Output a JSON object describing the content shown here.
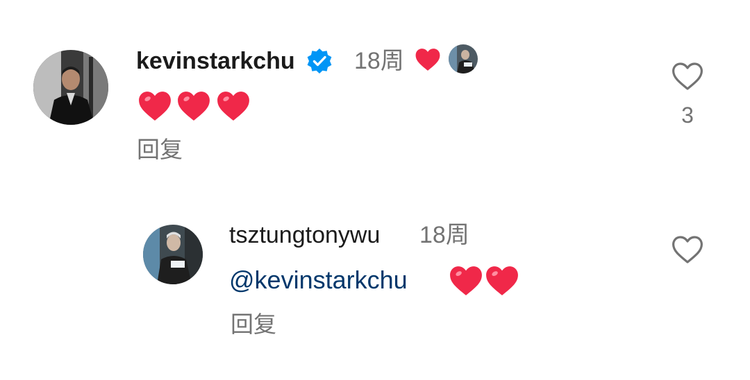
{
  "comment": {
    "username": "kevinstarkchu",
    "verified": true,
    "time": "18周",
    "text_emoji": [
      "heart",
      "heart",
      "heart"
    ],
    "reply_label": "回复",
    "like_count": "3",
    "liked_by_author": true
  },
  "reply": {
    "username": "tsztungtonywu",
    "time": "18周",
    "mention": "@kevinstarkchu",
    "text_emoji": [
      "heart",
      "heart"
    ],
    "reply_label": "回复"
  },
  "colors": {
    "heart_red": "#f02849",
    "verified_blue": "#0095f6",
    "mention_blue": "#00376b",
    "muted_gray": "#737373",
    "like_outline": "#737373"
  }
}
